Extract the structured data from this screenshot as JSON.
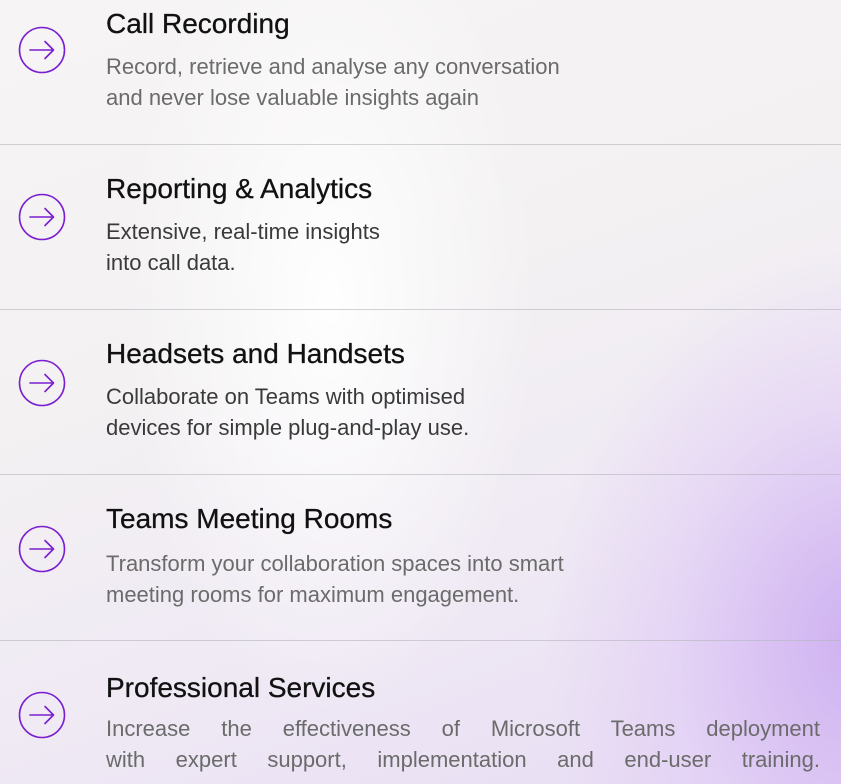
{
  "accent_color": "#7a1fd0",
  "items": [
    {
      "icon": "arrow-right-circle-icon",
      "title": "Call Recording",
      "desc_lines": [
        "Record, retrieve and analyse any conversation",
        "and never lose valuable insights again"
      ]
    },
    {
      "icon": "arrow-right-circle-icon",
      "title": "Reporting & Analytics",
      "desc_lines": [
        "Extensive, real-time insights",
        "into call data."
      ]
    },
    {
      "icon": "arrow-right-circle-icon",
      "title": "Headsets and Handsets",
      "desc_lines": [
        "Collaborate on Teams with optimised",
        "devices for simple plug-and-play use."
      ]
    },
    {
      "icon": "arrow-right-circle-icon",
      "title": "Teams Meeting Rooms",
      "desc_lines": [
        "Transform your collaboration spaces into smart",
        "meeting rooms for maximum engagement."
      ]
    },
    {
      "icon": "arrow-right-circle-icon",
      "title": "Professional Services",
      "desc_lines": [
        "Increase the effectiveness of Microsoft Teams deployment",
        "with expert support, implementation and end-user training."
      ]
    }
  ]
}
